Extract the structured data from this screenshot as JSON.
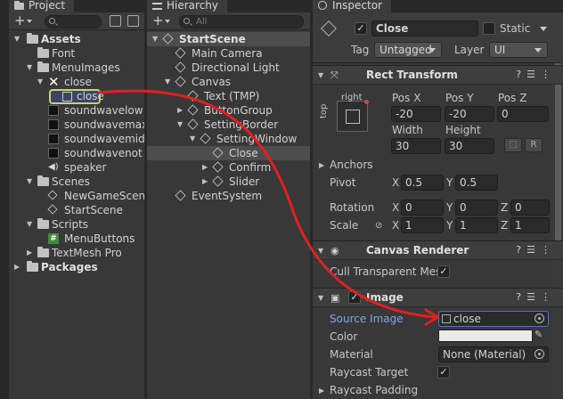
{
  "project": {
    "tab": "Project",
    "items": [
      {
        "label": "Assets",
        "type": "folder",
        "bold": true
      },
      {
        "label": "Font",
        "type": "folder"
      },
      {
        "label": "MenuImages",
        "type": "folder"
      },
      {
        "label": "close",
        "type": "sprite-x"
      },
      {
        "label": "close",
        "type": "sprite-sub",
        "selected": true
      },
      {
        "label": "soundwavelow",
        "type": "sprite-dark"
      },
      {
        "label": "soundwavemax",
        "type": "sprite-dark"
      },
      {
        "label": "soundwavemid",
        "type": "sprite-dark"
      },
      {
        "label": "soundwavenot",
        "type": "sprite-dark"
      },
      {
        "label": "speaker",
        "type": "audio"
      },
      {
        "label": "Scenes",
        "type": "folder"
      },
      {
        "label": "NewGameScene",
        "type": "unity"
      },
      {
        "label": "StartScene",
        "type": "unity"
      },
      {
        "label": "Scripts",
        "type": "folder"
      },
      {
        "label": "MenuButtons",
        "type": "script"
      },
      {
        "label": "TextMesh Pro",
        "type": "folder"
      },
      {
        "label": "Packages",
        "type": "folder",
        "bold": true
      }
    ]
  },
  "hierarchy": {
    "tab": "Hierarchy",
    "search_placeholder": "All",
    "items": [
      {
        "label": "StartScene",
        "bold": true
      },
      {
        "label": "Main Camera"
      },
      {
        "label": "Directional Light"
      },
      {
        "label": "Canvas"
      },
      {
        "label": "Text (TMP)"
      },
      {
        "label": "ButtonGroup"
      },
      {
        "label": "SettingBorder"
      },
      {
        "label": "SettingWindow"
      },
      {
        "label": "Close",
        "selected": true
      },
      {
        "label": "Confirm"
      },
      {
        "label": "Slider"
      },
      {
        "label": "EventSystem"
      }
    ]
  },
  "inspector": {
    "tab": "Inspector",
    "object_name": "Close",
    "static_label": "Static",
    "tag_label": "Tag",
    "tag_value": "Untagged",
    "layer_label": "Layer",
    "layer_value": "UI",
    "rect_transform": {
      "title": "Rect Transform",
      "anchor_h": "right",
      "anchor_v": "top",
      "pos_x_label": "Pos X",
      "pos_x": "-20",
      "pos_y_label": "Pos Y",
      "pos_y": "-20",
      "pos_z_label": "Pos Z",
      "pos_z": "0",
      "width_label": "Width",
      "width": "30",
      "height_label": "Height",
      "height": "30",
      "r_button": "R",
      "anchors_label": "Anchors",
      "pivot_label": "Pivot",
      "pivot_x": "0.5",
      "pivot_y": "0.5",
      "rotation_label": "Rotation",
      "rot_x": "0",
      "rot_y": "0",
      "rot_z": "0",
      "scale_label": "Scale",
      "scale_x": "1",
      "scale_y": "1",
      "scale_z": "1",
      "x": "X",
      "y": "Y",
      "z": "Z"
    },
    "canvas_renderer": {
      "title": "Canvas Renderer",
      "cull_label": "Cull Transparent Mes"
    },
    "image": {
      "title": "Image",
      "source_label": "Source Image",
      "source_value": "close",
      "color_label": "Color",
      "material_label": "Material",
      "material_value": "None (Material)",
      "raycast_label": "Raycast Target",
      "padding_label": "Raycast Padding"
    }
  },
  "colors": {
    "arrow": "#e02020",
    "selection": "#c9d46a",
    "label_blue": "#7ea6ea"
  }
}
